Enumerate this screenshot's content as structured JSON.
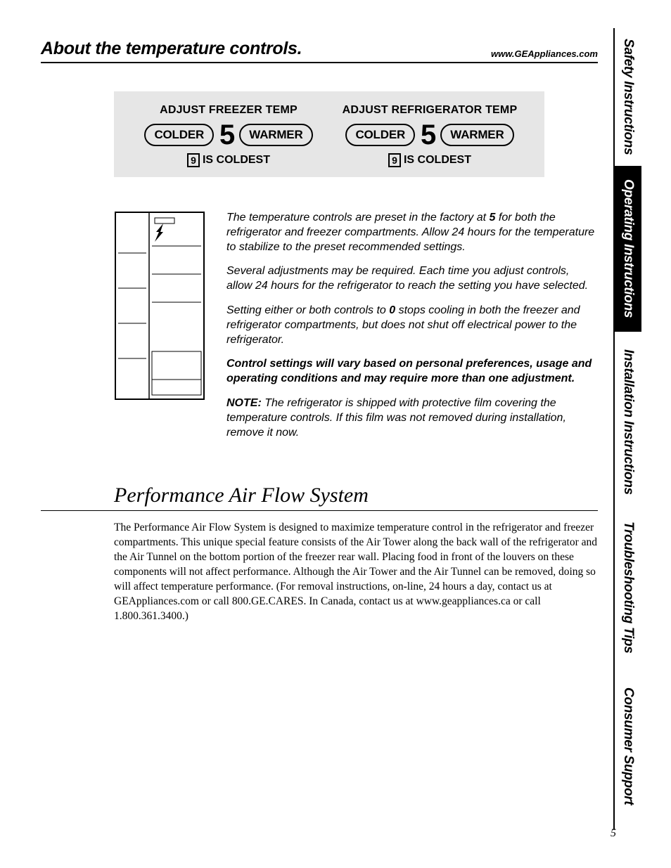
{
  "header": {
    "title": "About the temperature controls.",
    "url": "www.GEAppliances.com"
  },
  "controls": {
    "freezer": {
      "title": "ADJUST FREEZER TEMP",
      "colder": "COLDER",
      "value": "5",
      "warmer": "WARMER",
      "coldest_num": "9",
      "coldest_text": "IS COLDEST"
    },
    "fridge": {
      "title": "ADJUST REFRIGERATOR TEMP",
      "colder": "COLDER",
      "value": "5",
      "warmer": "WARMER",
      "coldest_num": "9",
      "coldest_text": "IS COLDEST"
    }
  },
  "body": {
    "p1a": "The temperature controls are preset in the factory at ",
    "p1num": "5",
    "p1b": " for both the refrigerator and freezer compartments. Allow 24 hours for the temperature to stabilize to the preset recommended settings.",
    "p2": "Several adjustments may be required. Each time you adjust controls, allow 24 hours for the refrigerator to reach the setting you have selected.",
    "p3a": "Setting either or both controls to ",
    "p3num": "0",
    "p3b": " stops cooling in both the freezer and refrigerator compartments, but does not shut off electrical power to the refrigerator.",
    "p4": "Control settings will vary based on personal preferences, usage and operating conditions and may require more than one adjustment.",
    "note_label": "NOTE:",
    "note_text": " The refrigerator is shipped with protective film covering the temperature controls. If this film was not removed during installation, remove it now."
  },
  "section2": {
    "title": "Performance Air Flow System",
    "body": "The Performance Air Flow System is designed to maximize temperature control in the refrigerator and freezer compartments. This unique special feature consists of the Air Tower along the back wall of the refrigerator and the Air Tunnel on the bottom portion of the freezer rear wall. Placing food in front of the louvers on these components will not affect performance. Although the Air Tower and the Air Tunnel can be removed, doing so will affect temperature performance. (For removal instructions, on-line, 24 hours a day, contact us at GEAppliances.com or call 800.GE.CARES. In Canada, contact us at www.geappliances.ca or call 1.800.361.3400.)"
  },
  "tabs": [
    "Safety Instructions",
    "Operating Instructions",
    "Installation Instructions",
    "Troubleshooting Tips",
    "Consumer Support"
  ],
  "page_number": "5"
}
